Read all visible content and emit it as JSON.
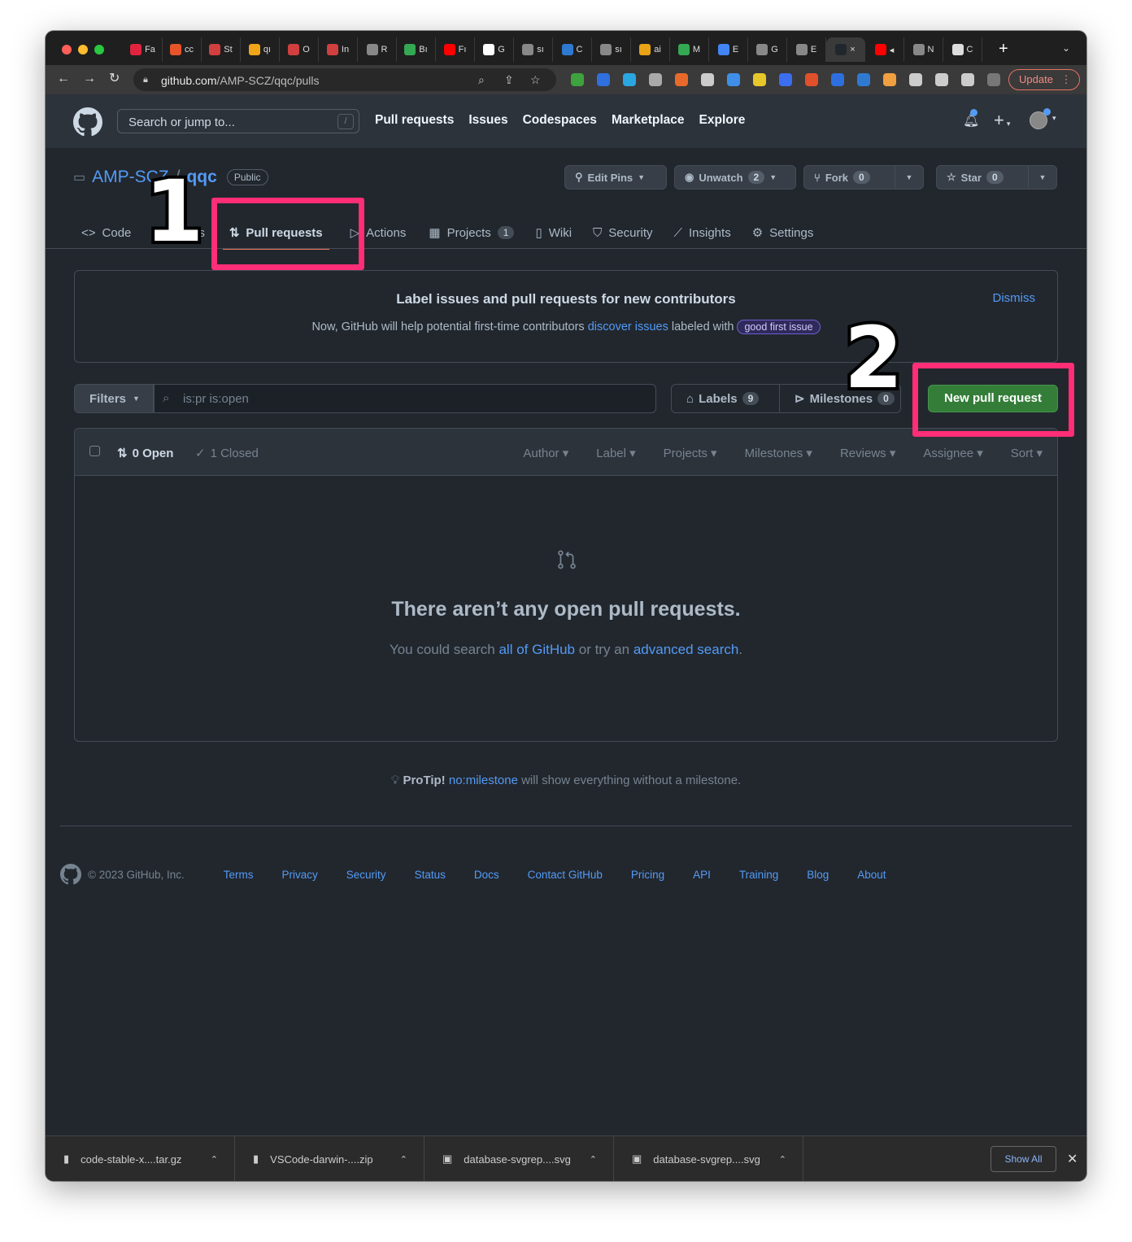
{
  "browser": {
    "tabs": [
      {
        "label": "Fa",
        "color": "#e0243d"
      },
      {
        "label": "cc",
        "color": "#e8542a"
      },
      {
        "label": "St",
        "color": "#d13f3f"
      },
      {
        "label": "qı",
        "color": "#f1a61a"
      },
      {
        "label": "O",
        "color": "#d13f3f"
      },
      {
        "label": "In",
        "color": "#d13f3f"
      },
      {
        "label": "R",
        "color": "#888888"
      },
      {
        "label": "Bı",
        "color": "#34a853"
      },
      {
        "label": "Fı",
        "color": "#ff0000"
      },
      {
        "label": "G",
        "color": "#ffffff"
      },
      {
        "label": "sı",
        "color": "#888888"
      },
      {
        "label": "C",
        "color": "#2f7ad1"
      },
      {
        "label": "sı",
        "color": "#888888"
      },
      {
        "label": "ai",
        "color": "#e8a317"
      },
      {
        "label": "M",
        "color": "#34a853"
      },
      {
        "label": "E",
        "color": "#4285f4"
      },
      {
        "label": "G",
        "color": "#888888"
      },
      {
        "label": "E",
        "color": "#888888"
      },
      {
        "label": "×",
        "color": "#22272e"
      },
      {
        "label": "◂",
        "color": "#ff0000"
      },
      {
        "label": "N",
        "color": "#888888"
      },
      {
        "label": "C",
        "color": "#dddddd"
      }
    ],
    "new_tab_label": "+",
    "url_host": "github.com",
    "url_path": "/AMP-SCZ/qqc/pulls",
    "update_label": "Update",
    "extensions": [
      "#3ea23e",
      "#2f6fde",
      "#2aa6e0",
      "#aaaaaa",
      "#e86a2a",
      "#cccccc",
      "#3f8fe8",
      "#e8c72a",
      "#3c6ef0",
      "#e0502a",
      "#2d6fde",
      "#2f7ad1",
      "#f0a040",
      "#cccccc",
      "#cccccc",
      "#cccccc",
      "#777777"
    ]
  },
  "header": {
    "search_placeholder": "Search or jump to...",
    "search_key": "/",
    "nav": [
      "Pull requests",
      "Issues",
      "Codespaces",
      "Marketplace",
      "Explore"
    ]
  },
  "repo": {
    "owner": "AMP-SCZ",
    "separator": "/",
    "name": "qqc",
    "visibility": "Public",
    "edit_pins": "Edit Pins",
    "unwatch": "Unwatch",
    "unwatch_count": "2",
    "fork": "Fork",
    "fork_count": "0",
    "star": "Star",
    "star_count": "0",
    "tabs": {
      "code": "Code",
      "issues": "Issues",
      "pull_requests": "Pull requests",
      "actions": "Actions",
      "projects": "Projects",
      "projects_count": "1",
      "wiki": "Wiki",
      "security": "Security",
      "insights": "Insights",
      "settings": "Settings"
    }
  },
  "banner": {
    "title": "Label issues and pull requests for new contributors",
    "text_before": "Now, GitHub will help potential first-time contributors ",
    "link": "discover issues",
    "text_after": " labeled with ",
    "label": "good first issue",
    "dismiss": "Dismiss"
  },
  "filters": {
    "button": "Filters",
    "query": "is:pr is:open",
    "labels": "Labels",
    "labels_count": "9",
    "milestones": "Milestones",
    "milestones_count": "0",
    "new_pr": "New pull request"
  },
  "list": {
    "open": "0 Open",
    "closed": "1 Closed",
    "sorts": [
      "Author",
      "Label",
      "Projects",
      "Milestones",
      "Reviews",
      "Assignee",
      "Sort"
    ],
    "empty_title": "There aren’t any open pull requests.",
    "empty_before": "You could search ",
    "empty_link1": "all of GitHub",
    "empty_middle": " or try an ",
    "empty_link2": "advanced search",
    "empty_after": "."
  },
  "protip": {
    "label": "ProTip!",
    "link": "no:milestone",
    "text": " will show everything without a milestone."
  },
  "footer": {
    "copyright": "© 2023 GitHub, Inc.",
    "links": [
      "Terms",
      "Privacy",
      "Security",
      "Status",
      "Docs",
      "Contact GitHub",
      "Pricing",
      "API",
      "Training",
      "Blog",
      "About"
    ]
  },
  "downloads": {
    "items": [
      "code-stable-x....tar.gz",
      "VSCode-darwin-....zip",
      "database-svgrep....svg",
      "database-svgrep....svg"
    ],
    "show_all": "Show All"
  },
  "annotations": {
    "step1": "1",
    "step2": "2",
    "color": "#ff2e76"
  }
}
